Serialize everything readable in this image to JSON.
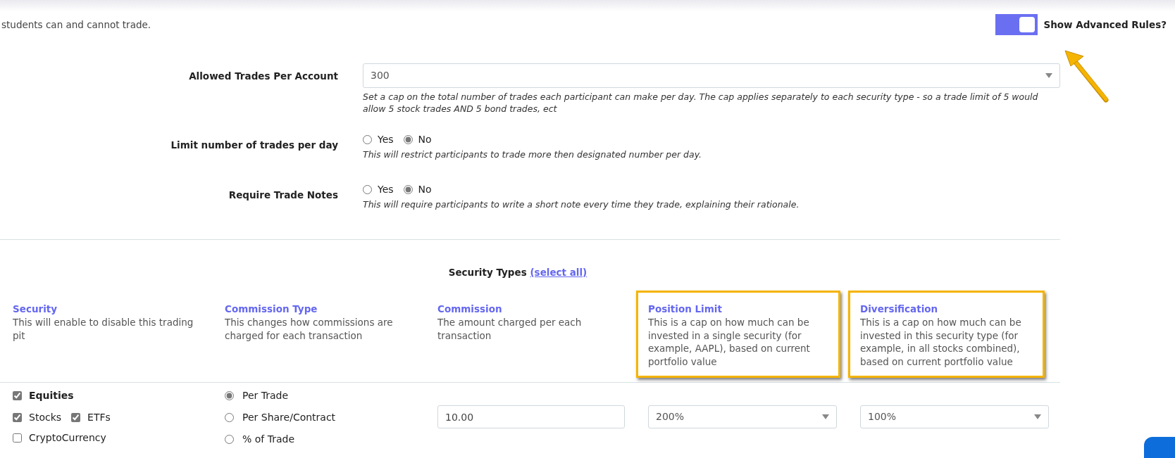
{
  "intro": "students can and cannot trade.",
  "advanced_toggle": {
    "label": "Show Advanced Rules?",
    "on": true,
    "pointed_at": true
  },
  "settings": [
    {
      "kind": "select",
      "label": "Allowed Trades Per Account",
      "value": "300",
      "help": "Set a cap on the total number of trades each participant can make per day. The cap applies separately to each security type - so a trade limit of 5 would allow 5 stock trades AND 5 bond trades, ect"
    },
    {
      "kind": "radio",
      "label": "Limit number of trades per day",
      "options": [
        {
          "label": "Yes",
          "selected": false
        },
        {
          "label": "No",
          "selected": true
        }
      ],
      "help": "This will restrict participants to trade more then designated number per day."
    },
    {
      "kind": "radio",
      "label": "Require Trade Notes",
      "options": [
        {
          "label": "Yes",
          "selected": false
        },
        {
          "label": "No",
          "selected": true
        }
      ],
      "help": "This will require participants to write a short note every time they trade, explaining their rationale."
    }
  ],
  "security_types": {
    "title": "Security Types",
    "select_all": "(select all)"
  },
  "columns": [
    {
      "title": "Security",
      "description": "This will enable to disable this trading pit",
      "highlighted": false
    },
    {
      "title": "Commission Type",
      "description": "This changes how commissions are charged for each transaction",
      "highlighted": false
    },
    {
      "title": "Commission",
      "description": "The amount charged per each transaction",
      "highlighted": false
    },
    {
      "title": "Position Limit",
      "description": "This is a cap on how much can be invested in a single security (for example, AAPL), based on current portfolio value",
      "highlighted": true
    },
    {
      "title": "Diversification",
      "description": "This is a cap on how much can be invested in this security type (for example, in all stocks combined), based on current portfolio value",
      "highlighted": true
    }
  ],
  "securities": [
    {
      "group": {
        "label": "Equities",
        "checked": true
      },
      "types": [
        {
          "label": "Stocks",
          "checked": true
        },
        {
          "label": "ETFs",
          "checked": true
        },
        {
          "label": "CryptoCurrency",
          "checked": false
        }
      ],
      "commission_types": [
        {
          "label": "Per Trade",
          "selected": true
        },
        {
          "label": "Per Share/Contract",
          "selected": false
        },
        {
          "label": "% of Trade",
          "selected": false
        }
      ],
      "commission": "10.00",
      "position_limit": "200%",
      "diversification": "100%"
    }
  ]
}
